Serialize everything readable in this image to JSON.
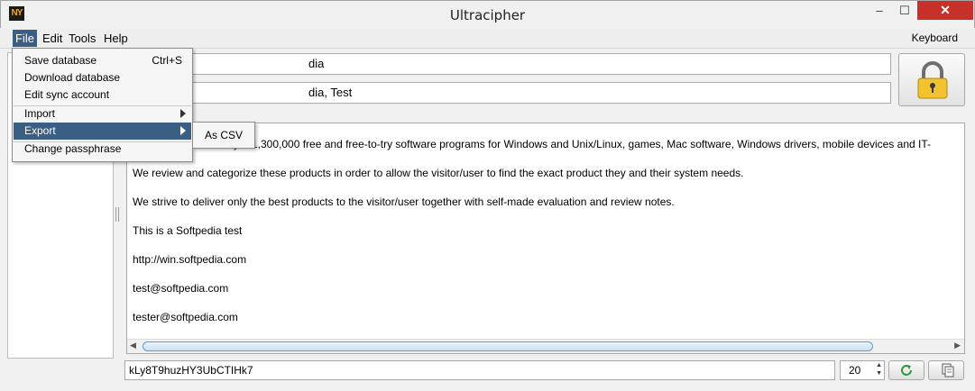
{
  "window": {
    "title": "Ultracipher",
    "app_icon_text": "NY",
    "minimize_glyph": "–",
    "maximize_glyph": "☐",
    "close_glyph": "✕"
  },
  "menubar": {
    "file": "File",
    "edit": "Edit",
    "tools": "Tools",
    "help": "Help",
    "keyboard": "Keyboard"
  },
  "file_menu": {
    "save_database": "Save database",
    "save_shortcut": "Ctrl+S",
    "download_database": "Download database",
    "edit_sync_account": "Edit sync account",
    "import": "Import",
    "export": "Export",
    "change_passphrase": "Change passphrase"
  },
  "export_submenu": {
    "as_csv": "As CSV"
  },
  "entry": {
    "name_visible": "dia",
    "tags_visible": "dia, Test"
  },
  "notes": {
    "lines": [
      "yer 1,300,000 free and free-to-try software programs for Windows and Unix/Linux, games, Mac software, Windows drivers, mobile devices and IT-",
      "We review and categorize these products in order to allow the visitor/user to find the exact product they and their system needs.",
      "We strive to deliver only the best products to the visitor/user together with self-made evaluation and review notes.",
      "This is a Softpedia test",
      "http://win.softpedia.com",
      "test@softpedia.com",
      "tester@softpedia.com"
    ]
  },
  "generator": {
    "password": "kLy8T9huzHY3UbCTIHk7",
    "length": "20"
  },
  "icons": {
    "lock": "lock-icon",
    "refresh": "refresh-icon",
    "copy": "copy-icon"
  },
  "colors": {
    "menu_highlight": "#3b5e84",
    "close_button": "#c7312a",
    "lock_body": "#f2c230",
    "refresh_green": "#2e9a3a"
  }
}
